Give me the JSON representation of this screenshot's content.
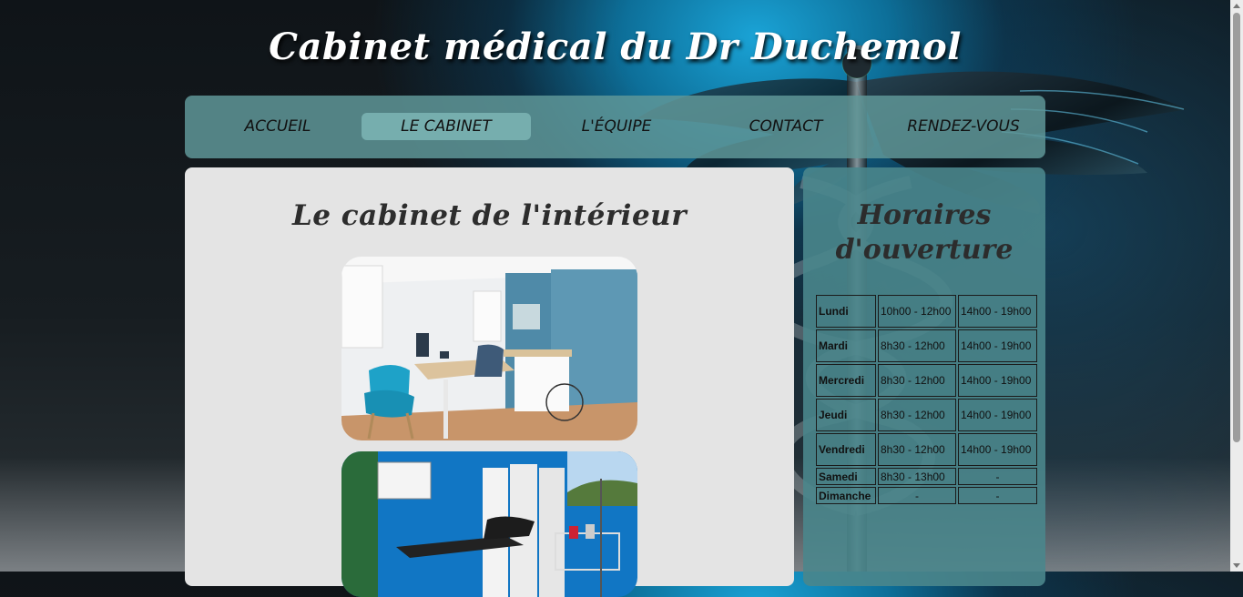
{
  "site": {
    "title": "Cabinet médical du Dr Duchemol"
  },
  "nav": {
    "items": [
      {
        "label": "ACCUEIL"
      },
      {
        "label": "LE CABINET",
        "active": true
      },
      {
        "label": "L'ÉQUIPE"
      },
      {
        "label": "CONTACT"
      },
      {
        "label": "RENDEZ-VOUS"
      }
    ]
  },
  "main": {
    "title": "Le cabinet de l'intérieur"
  },
  "hours": {
    "title": "Horaires d'ouverture",
    "rows": [
      {
        "day": "Lundi",
        "am": "10h00 - 12h00",
        "pm": "14h00 - 19h00"
      },
      {
        "day": "Mardi",
        "am": "8h30 - 12h00",
        "pm": "14h00 - 19h00"
      },
      {
        "day": "Mercredi",
        "am": "8h30 - 12h00",
        "pm": "14h00 - 19h00"
      },
      {
        "day": "Jeudi",
        "am": "8h30 - 12h00",
        "pm": "14h00 - 19h00"
      },
      {
        "day": "Vendredi",
        "am": "8h30 - 12h00",
        "pm": "14h00 - 19h00"
      },
      {
        "day": "Samedi",
        "am": "8h30 - 13h00",
        "pm": "-"
      },
      {
        "day": "Dimanche",
        "am": "-",
        "pm": "-"
      }
    ]
  },
  "colors": {
    "nav_bg": "#5f9698",
    "nav_active": "#76aeae",
    "aside_bg": "#4a868c",
    "main_bg": "#e4e4e4"
  }
}
